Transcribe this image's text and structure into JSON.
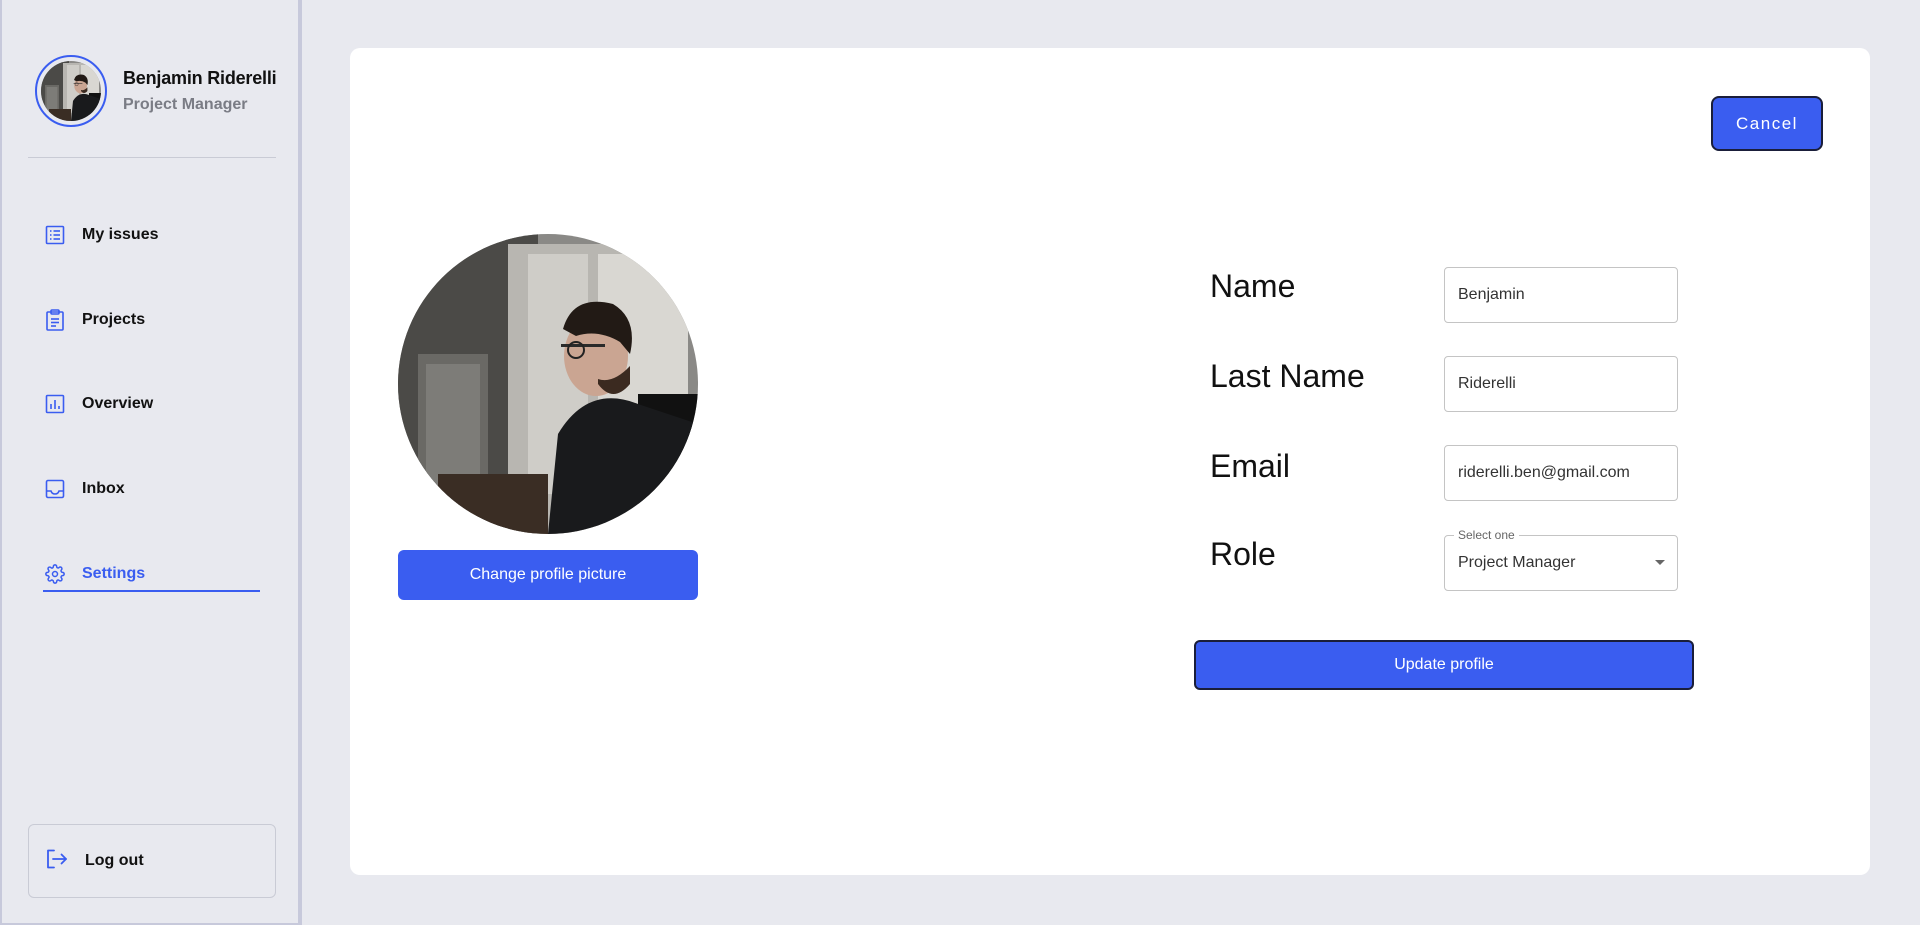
{
  "sidebar": {
    "user": {
      "name": "Benjamin Riderelli",
      "role": "Project Manager"
    },
    "items": [
      {
        "label": "My issues",
        "icon": "list-icon"
      },
      {
        "label": "Projects",
        "icon": "clipboard-icon"
      },
      {
        "label": "Overview",
        "icon": "bar-chart-icon"
      },
      {
        "label": "Inbox",
        "icon": "inbox-icon"
      },
      {
        "label": "Settings",
        "icon": "gear-icon",
        "active": true
      }
    ],
    "logout_label": "Log out"
  },
  "main": {
    "cancel_label": "Cancel",
    "change_picture_label": "Change profile picture",
    "form": {
      "name_label": "Name",
      "name_value": "Benjamin",
      "lastname_label": "Last Name",
      "lastname_value": "Riderelli",
      "email_label": "Email",
      "email_value": "riderelli.ben@gmail.com",
      "role_label": "Role",
      "role_legend": "Select one",
      "role_value": "Project Manager"
    },
    "update_label": "Update profile"
  },
  "colors": {
    "accent": "#3a5df0",
    "background": "#e8e9ef",
    "card": "#ffffff"
  }
}
